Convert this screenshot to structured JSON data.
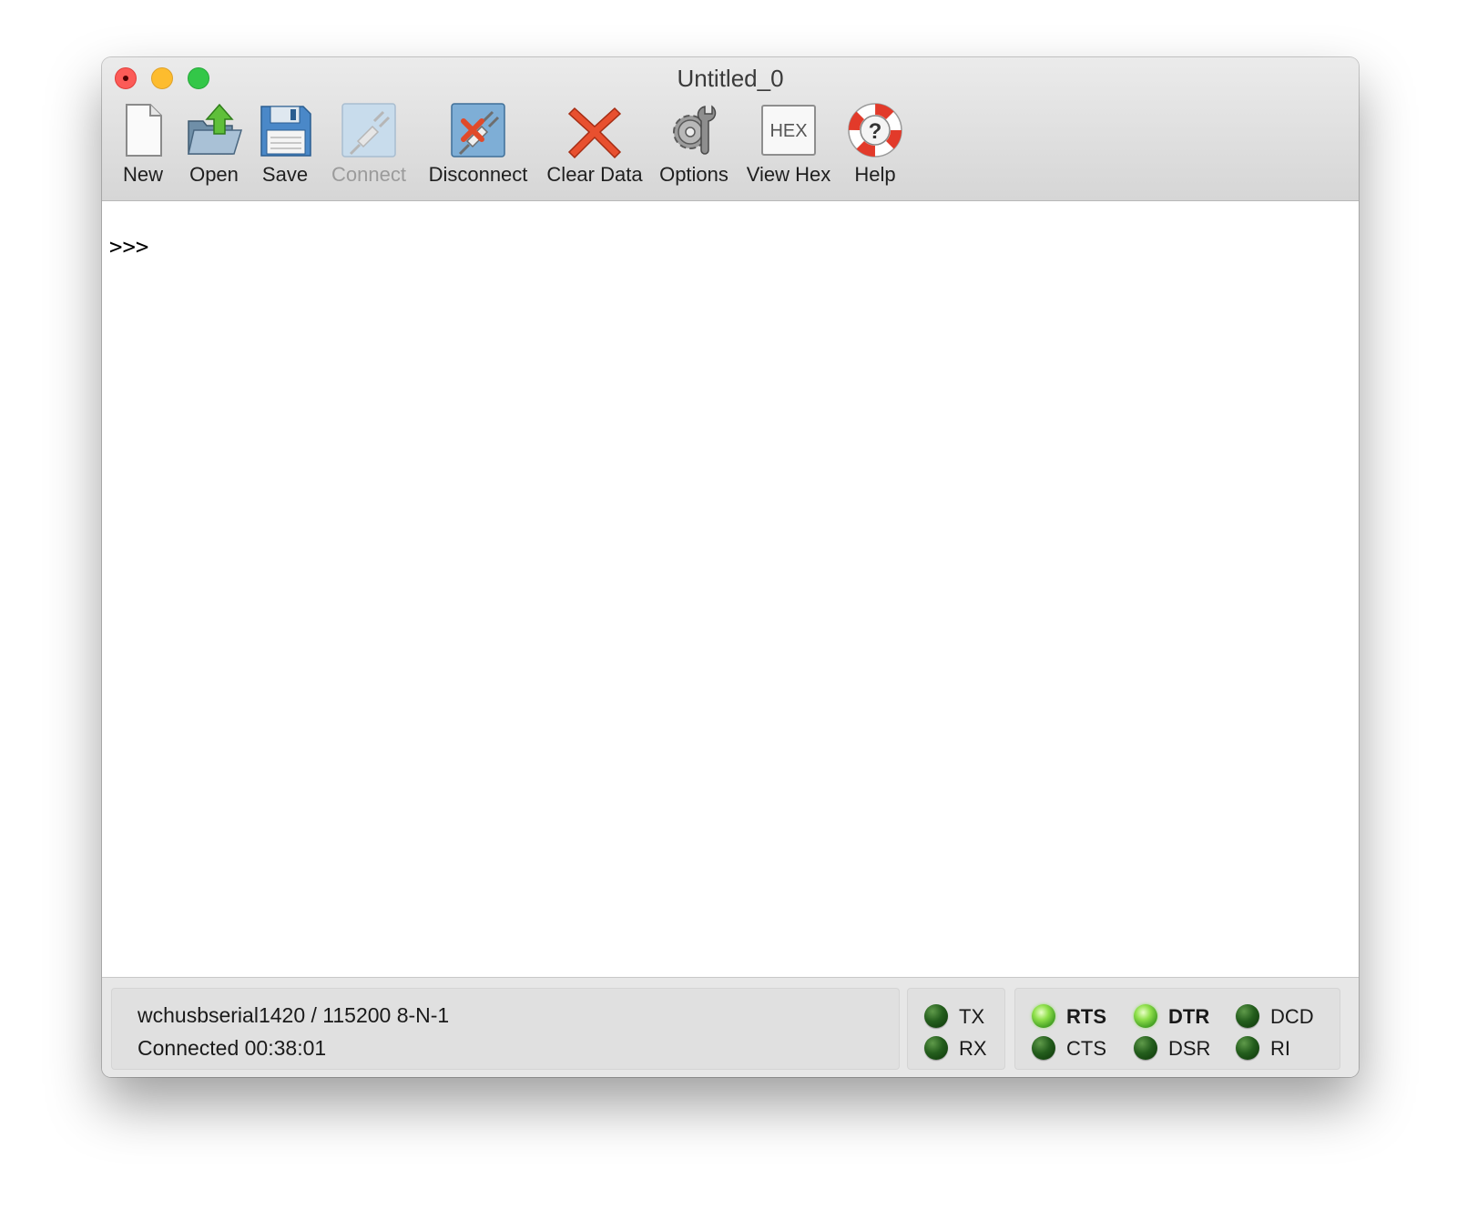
{
  "window": {
    "title": "Untitled_0"
  },
  "toolbar": {
    "items": [
      {
        "label": "New",
        "icon": "new-document-icon",
        "enabled": true
      },
      {
        "label": "Open",
        "icon": "open-folder-icon",
        "enabled": true
      },
      {
        "label": "Save",
        "icon": "save-floppy-icon",
        "enabled": true
      },
      {
        "label": "Connect",
        "icon": "connect-plug-icon",
        "enabled": false
      },
      {
        "label": "Disconnect",
        "icon": "disconnect-plug-icon",
        "enabled": true
      },
      {
        "label": "Clear Data",
        "icon": "clear-x-icon",
        "enabled": true
      },
      {
        "label": "Options",
        "icon": "gear-wrench-icon",
        "enabled": true
      },
      {
        "label": "View Hex",
        "icon": "hex-icon",
        "enabled": true
      },
      {
        "label": "Help",
        "icon": "lifebuoy-help-icon",
        "enabled": true
      }
    ],
    "hex_icon_text": "HEX",
    "help_icon_text": "?"
  },
  "terminal": {
    "prompt": ">>>"
  },
  "status": {
    "port_line": "wchusbserial1420 / 115200 8-N-1",
    "connection_line": "Connected 00:38:01"
  },
  "signals": {
    "tx": {
      "label": "TX",
      "active": false
    },
    "rx": {
      "label": "RX",
      "active": false
    },
    "rts": {
      "label": "RTS",
      "active": true
    },
    "cts": {
      "label": "CTS",
      "active": false
    },
    "dtr": {
      "label": "DTR",
      "active": true
    },
    "dsr": {
      "label": "DSR",
      "active": false
    },
    "dcd": {
      "label": "DCD",
      "active": false
    },
    "ri": {
      "label": "RI",
      "active": false
    }
  },
  "colors": {
    "led_off": "#245e1d",
    "led_on": "#8fe04b",
    "traffic_close": "#fc5b57",
    "traffic_minimize": "#fdbc2e",
    "traffic_zoom": "#33c748"
  }
}
